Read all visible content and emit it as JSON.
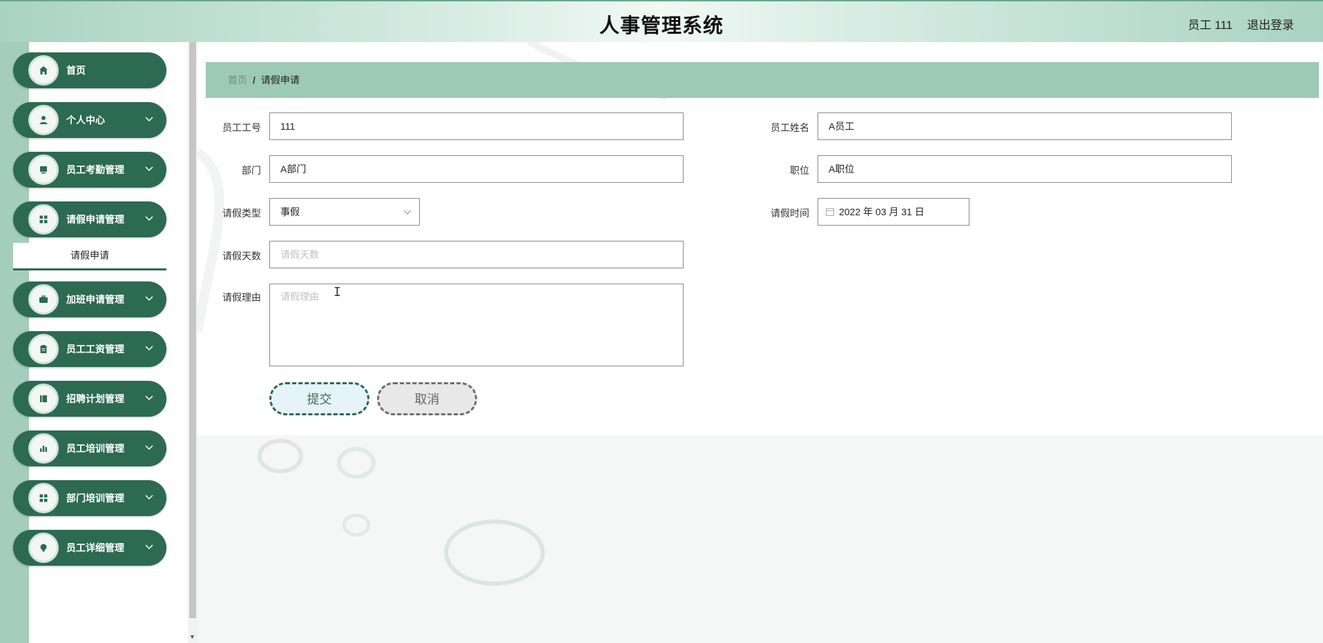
{
  "header": {
    "title": "人事管理系统",
    "user": "员工 111",
    "logout": "退出登录"
  },
  "sidebar": {
    "items": [
      {
        "label": "首页",
        "icon": "home-icon",
        "has_chevron": false
      },
      {
        "label": "个人中心",
        "icon": "user-icon",
        "has_chevron": true
      },
      {
        "label": "员工考勤管理",
        "icon": "monitor-icon",
        "has_chevron": true
      },
      {
        "label": "请假申请管理",
        "icon": "grid-icon",
        "has_chevron": true
      },
      {
        "label": "加班申请管理",
        "icon": "briefcase-icon",
        "has_chevron": true
      },
      {
        "label": "员工工资管理",
        "icon": "clipboard-icon",
        "has_chevron": true
      },
      {
        "label": "招聘计划管理",
        "icon": "book-icon",
        "has_chevron": true
      },
      {
        "label": "员工培训管理",
        "icon": "bar-chart-icon",
        "has_chevron": true
      },
      {
        "label": "部门培训管理",
        "icon": "grid-icon",
        "has_chevron": true
      },
      {
        "label": "员工详细管理",
        "icon": "bulb-icon",
        "has_chevron": true
      }
    ],
    "submenu_active": "请假申请"
  },
  "breadcrumb": {
    "home": "首页",
    "separator": "/",
    "current": "请假申请"
  },
  "form": {
    "employee_id_label": "员工工号",
    "employee_id_value": "111",
    "employee_name_label": "员工姓名",
    "employee_name_value": "A员工",
    "department_label": "部门",
    "department_value": "A部门",
    "position_label": "职位",
    "position_value": "A职位",
    "leave_type_label": "请假类型",
    "leave_type_value": "事假",
    "leave_time_label": "请假时间",
    "leave_time_value": "2022 年 03 月 31 日",
    "leave_days_label": "请假天数",
    "leave_days_placeholder": "请假天数",
    "leave_reason_label": "请假理由",
    "leave_reason_placeholder": "请假理由",
    "submit_label": "提交",
    "cancel_label": "取消"
  },
  "colors": {
    "primary": "#2c6a52",
    "breadcrumb_bg": "#9ccab5",
    "sidebar_strip": "#a4cdbd"
  }
}
